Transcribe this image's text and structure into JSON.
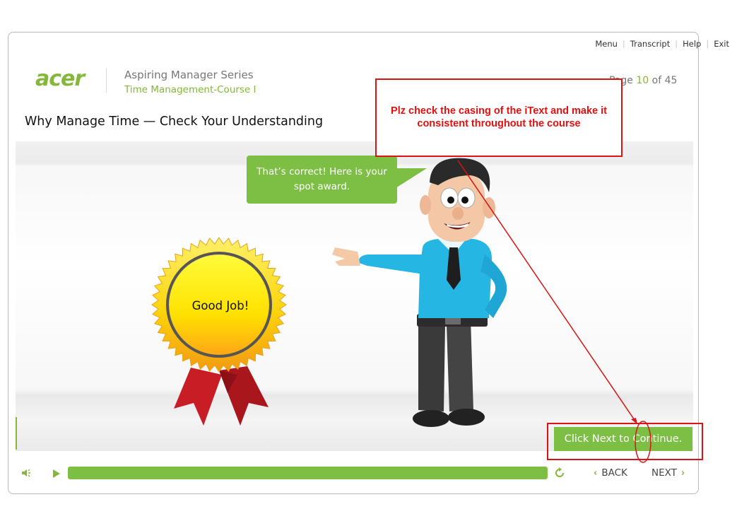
{
  "top_nav": {
    "menu": "Menu",
    "transcript": "Transcript",
    "help": "Help",
    "exit": "Exit"
  },
  "header": {
    "logo": "acer",
    "series_title": "Aspiring Manager Series",
    "course_title": "Time Management-Course I",
    "page_label_prefix": "Page",
    "page_current": "10",
    "page_of": "of",
    "page_total": "45"
  },
  "screen_title": "Why Manage Time — Check Your Understanding",
  "stage": {
    "speech_bubble": "That’s correct! Here is your spot award.",
    "award_text": "Good Job!",
    "continue_button": "Click Next to Continue."
  },
  "controls": {
    "progress_fraction": 1.0,
    "back_label": "BACK",
    "next_label": "NEXT"
  },
  "review_annotation": {
    "comment": "Plz check the casing of the iText and make it consistent throughout the course"
  },
  "colors": {
    "accent": "#7dbe45",
    "annotation": "#d81414"
  }
}
